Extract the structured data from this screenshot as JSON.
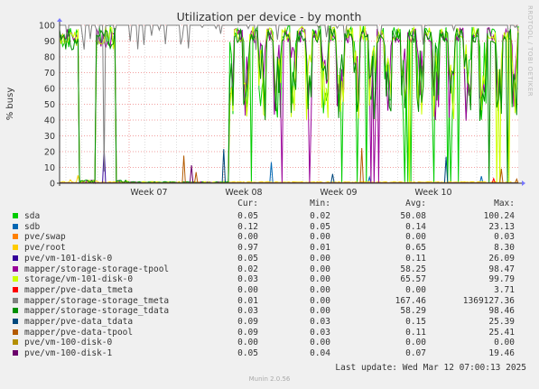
{
  "title": "Utilization per device - by month",
  "side_text": "RRDTOOL / TOBI OETIKER",
  "legend_headers": {
    "cur": "Cur:",
    "min": "Min:",
    "avg": "Avg:",
    "max": "Max:"
  },
  "last_update": "Last update: Wed Mar 12 07:00:13 2025",
  "footer": "Munin 2.0.56",
  "chart_data": {
    "type": "line",
    "title": "Utilization per device - by month",
    "ylabel": "% busy",
    "ylim": [
      0,
      100
    ],
    "yticks": [
      0,
      10,
      20,
      30,
      40,
      50,
      60,
      70,
      80,
      90,
      100
    ],
    "xticks": [
      "Week 07",
      "Week 08",
      "Week 09",
      "Week 10"
    ],
    "grid": true,
    "series": [
      {
        "name": "sda",
        "color": "#00cc00",
        "cur": "0.05",
        "min": "0.02",
        "avg": "50.08",
        "max": "100.24"
      },
      {
        "name": "sdb",
        "color": "#0066b3",
        "cur": "0.12",
        "min": "0.05",
        "avg": "0.14",
        "max": "23.13"
      },
      {
        "name": "pve/swap",
        "color": "#ff8000",
        "cur": "0.00",
        "min": "0.00",
        "avg": "0.00",
        "max": "0.03"
      },
      {
        "name": "pve/root",
        "color": "#ffcc00",
        "cur": "0.97",
        "min": "0.01",
        "avg": "0.65",
        "max": "8.30"
      },
      {
        "name": "pve/vm-101-disk-0",
        "color": "#330099",
        "cur": "0.05",
        "min": "0.00",
        "avg": "0.11",
        "max": "26.09"
      },
      {
        "name": "mapper/storage-storage-tpool",
        "color": "#990099",
        "cur": "0.02",
        "min": "0.00",
        "avg": "58.25",
        "max": "98.47"
      },
      {
        "name": "storage/vm-101-disk-0",
        "color": "#ccff00",
        "cur": "0.03",
        "min": "0.00",
        "avg": "65.57",
        "max": "99.79"
      },
      {
        "name": "mapper/pve-data_tmeta",
        "color": "#ff0000",
        "cur": "0.00",
        "min": "0.00",
        "avg": "0.00",
        "max": "3.71"
      },
      {
        "name": "mapper/storage-storage_tmeta",
        "color": "#808080",
        "cur": "0.01",
        "min": "0.00",
        "avg": "167.46",
        "max": "1369127.36"
      },
      {
        "name": "mapper/storage-storage_tdata",
        "color": "#008f00",
        "cur": "0.03",
        "min": "0.00",
        "avg": "58.29",
        "max": "98.46"
      },
      {
        "name": "mapper/pve-data_tdata",
        "color": "#00487d",
        "cur": "0.09",
        "min": "0.03",
        "avg": "0.15",
        "max": "25.39"
      },
      {
        "name": "mapper/pve-data-tpool",
        "color": "#b35a00",
        "cur": "0.09",
        "min": "0.03",
        "avg": "0.11",
        "max": "25.41"
      },
      {
        "name": "pve/vm-100-disk-0",
        "color": "#b38f00",
        "cur": "0.00",
        "min": "0.00",
        "avg": "0.00",
        "max": "0.00"
      },
      {
        "name": "pve/vm-100-disk-1",
        "color": "#6b006b",
        "cur": "0.05",
        "min": "0.04",
        "avg": "0.07",
        "max": "19.46"
      }
    ]
  }
}
